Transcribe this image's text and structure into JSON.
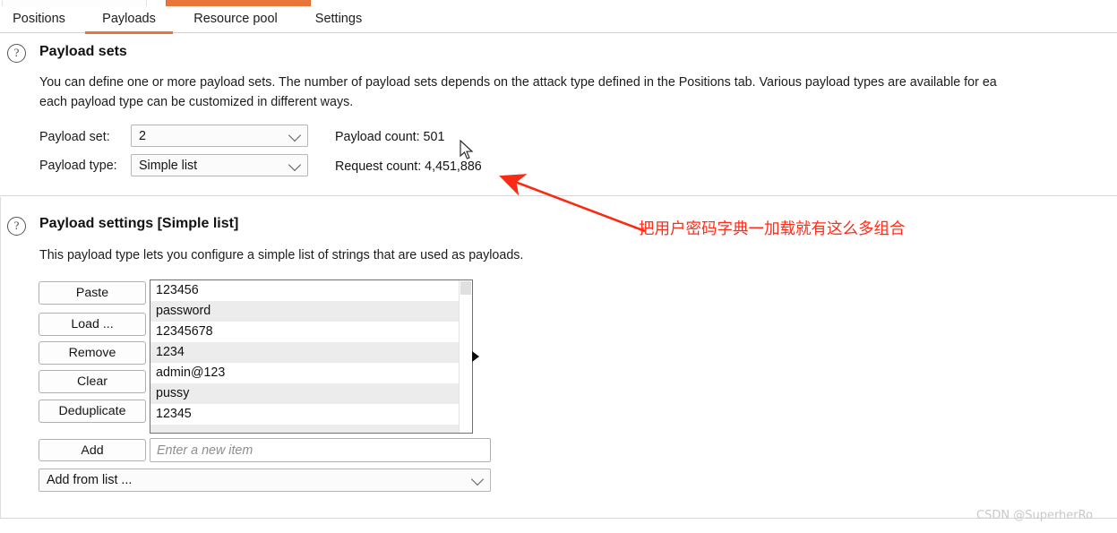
{
  "window": {
    "partial_tabs": [
      {
        "name": "inactive-ghost-tab",
        "state": "inactive"
      },
      {
        "name": "active-ghost-tab",
        "state": "active",
        "color": "#e8763a"
      }
    ]
  },
  "tabbar": {
    "accent_color": "#e8753b",
    "tabs": [
      {
        "label": "Positions",
        "selected": false
      },
      {
        "label": "Payloads",
        "selected": true
      },
      {
        "label": "Resource pool",
        "selected": false
      },
      {
        "label": "Settings",
        "selected": false
      }
    ]
  },
  "payload_sets": {
    "help_icon": "question-mark-icon",
    "title": "Payload sets",
    "description_line1": "You can define one or more payload sets. The number of payload sets depends on the attack type defined in the Positions tab. Various payload types are available for ea",
    "description_line2": "each payload type can be customized in different ways.",
    "payload_set_label": "Payload set:",
    "payload_set_value": "2",
    "payload_type_label": "Payload type:",
    "payload_type_value": "Simple list",
    "payload_count_text": "Payload count: 501",
    "request_count_text": "Request count: 4,451,886"
  },
  "payload_settings": {
    "help_icon": "question-mark-icon",
    "title": "Payload settings [Simple list]",
    "description": "This payload type lets you configure a simple list of strings that are used as payloads.",
    "buttons": [
      {
        "label": "Paste",
        "name": "paste-button"
      },
      {
        "label": "Load ...",
        "name": "load-button"
      },
      {
        "label": "Remove",
        "name": "remove-button"
      },
      {
        "label": "Clear",
        "name": "clear-button"
      },
      {
        "label": "Deduplicate",
        "name": "deduplicate-button"
      }
    ],
    "payload_list": [
      "123456",
      "password",
      "12345678",
      "1234",
      "admin@123",
      "pussy",
      "12345"
    ],
    "add_button_label": "Add",
    "new_item_placeholder": "Enter a new item",
    "new_item_value": "",
    "add_from_list_label": "Add from list ..."
  },
  "annotation": {
    "text": "把用户密码字典一加载就有这么多组合",
    "color": "#ff2d1a"
  },
  "watermark": {
    "text": "CSDN @SuperherRo"
  }
}
